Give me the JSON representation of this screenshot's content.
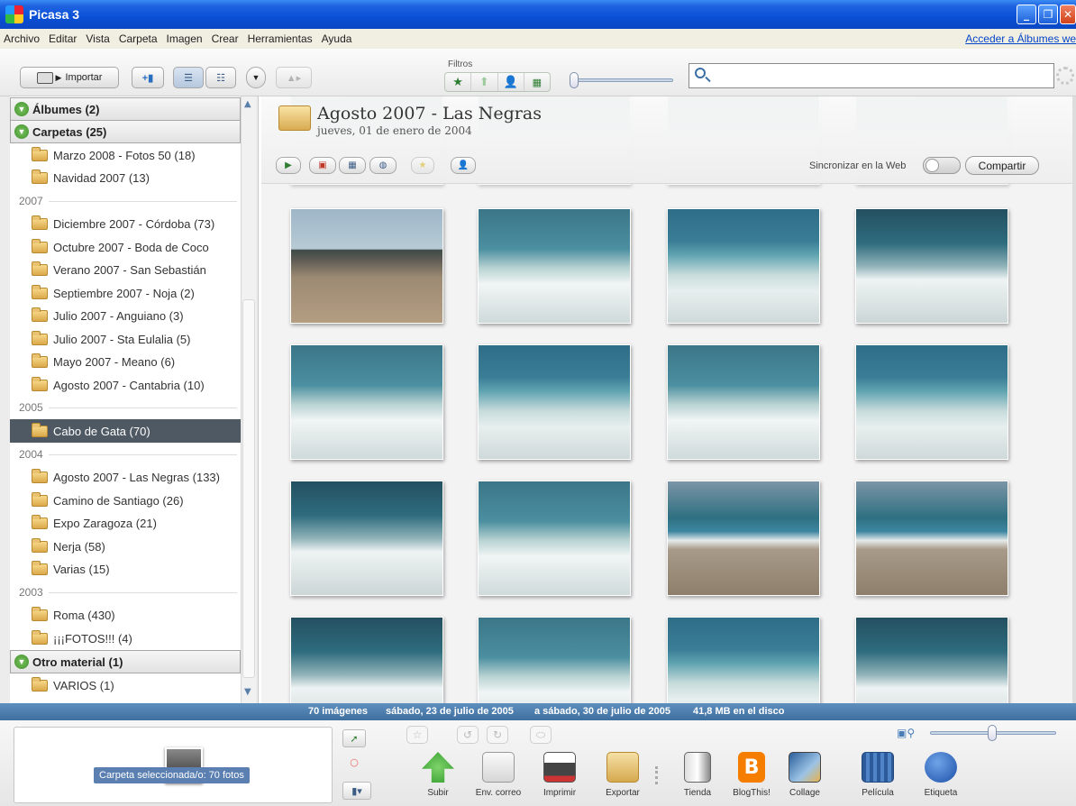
{
  "window": {
    "title": "Picasa 3",
    "min": "_",
    "max": "❐",
    "close": "✕"
  },
  "menu": {
    "items": [
      "Archivo",
      "Editar",
      "Vista",
      "Carpeta",
      "Imagen",
      "Crear",
      "Herramientas",
      "Ayuda"
    ],
    "signin_link": "Acceder a Álbumes we"
  },
  "toolbar": {
    "import_label": "Importar",
    "filters_label": "Filtros",
    "search_value": ""
  },
  "sidebar": {
    "sections": {
      "albums": "Álbumes (2)",
      "folders": "Carpetas (25)",
      "other": "Otro material (1)"
    },
    "years": [
      "2007",
      "2005",
      "2004",
      "2003"
    ],
    "folders_top": [
      "Marzo 2008 - Fotos 50 (18)",
      "Navidad 2007 (13)"
    ],
    "folders_2007": [
      "Diciembre 2007 - Córdoba (73)",
      "Octubre 2007 - Boda de Coco",
      "Verano 2007 - San Sebastián",
      "Septiembre 2007 - Noja (2)",
      "Julio 2007 - Anguiano (3)",
      "Julio 2007 - Sta Eulalia (5)",
      "Mayo 2007 - Meano (6)",
      "Agosto 2007 - Cantabria (10)"
    ],
    "folders_2005": [
      "Cabo de Gata (70)"
    ],
    "folders_2004": [
      "Agosto 2007 - Las Negras (133)",
      "Camino de Santiago (26)",
      "Expo Zaragoza (21)",
      "Nerja (58)",
      "Varias (15)"
    ],
    "folders_2003": [
      "Roma (430)",
      "¡¡¡FOTOS!!! (4)"
    ],
    "folders_other": [
      "VARIOS (1)"
    ]
  },
  "album": {
    "title": "Agosto 2007 - Las Negras",
    "date": "jueves, 01 de enero de 2004",
    "sync_label": "Sincronizar en la Web",
    "share_label": "Compartir"
  },
  "status": {
    "count": "70 imágenes",
    "from": "sábado, 23 de julio de 2005",
    "to": "a sábado, 30 de julio de 2005",
    "size": "41,8 MB en el disco"
  },
  "tray": {
    "selection_label": "Carpeta seleccionada/o: 70 fotos",
    "actions": [
      "Subir",
      "Env. correo",
      "Imprimir",
      "Exportar",
      "Tienda",
      "BlogThis!",
      "Collage",
      "Película",
      "Etiqueta"
    ]
  }
}
